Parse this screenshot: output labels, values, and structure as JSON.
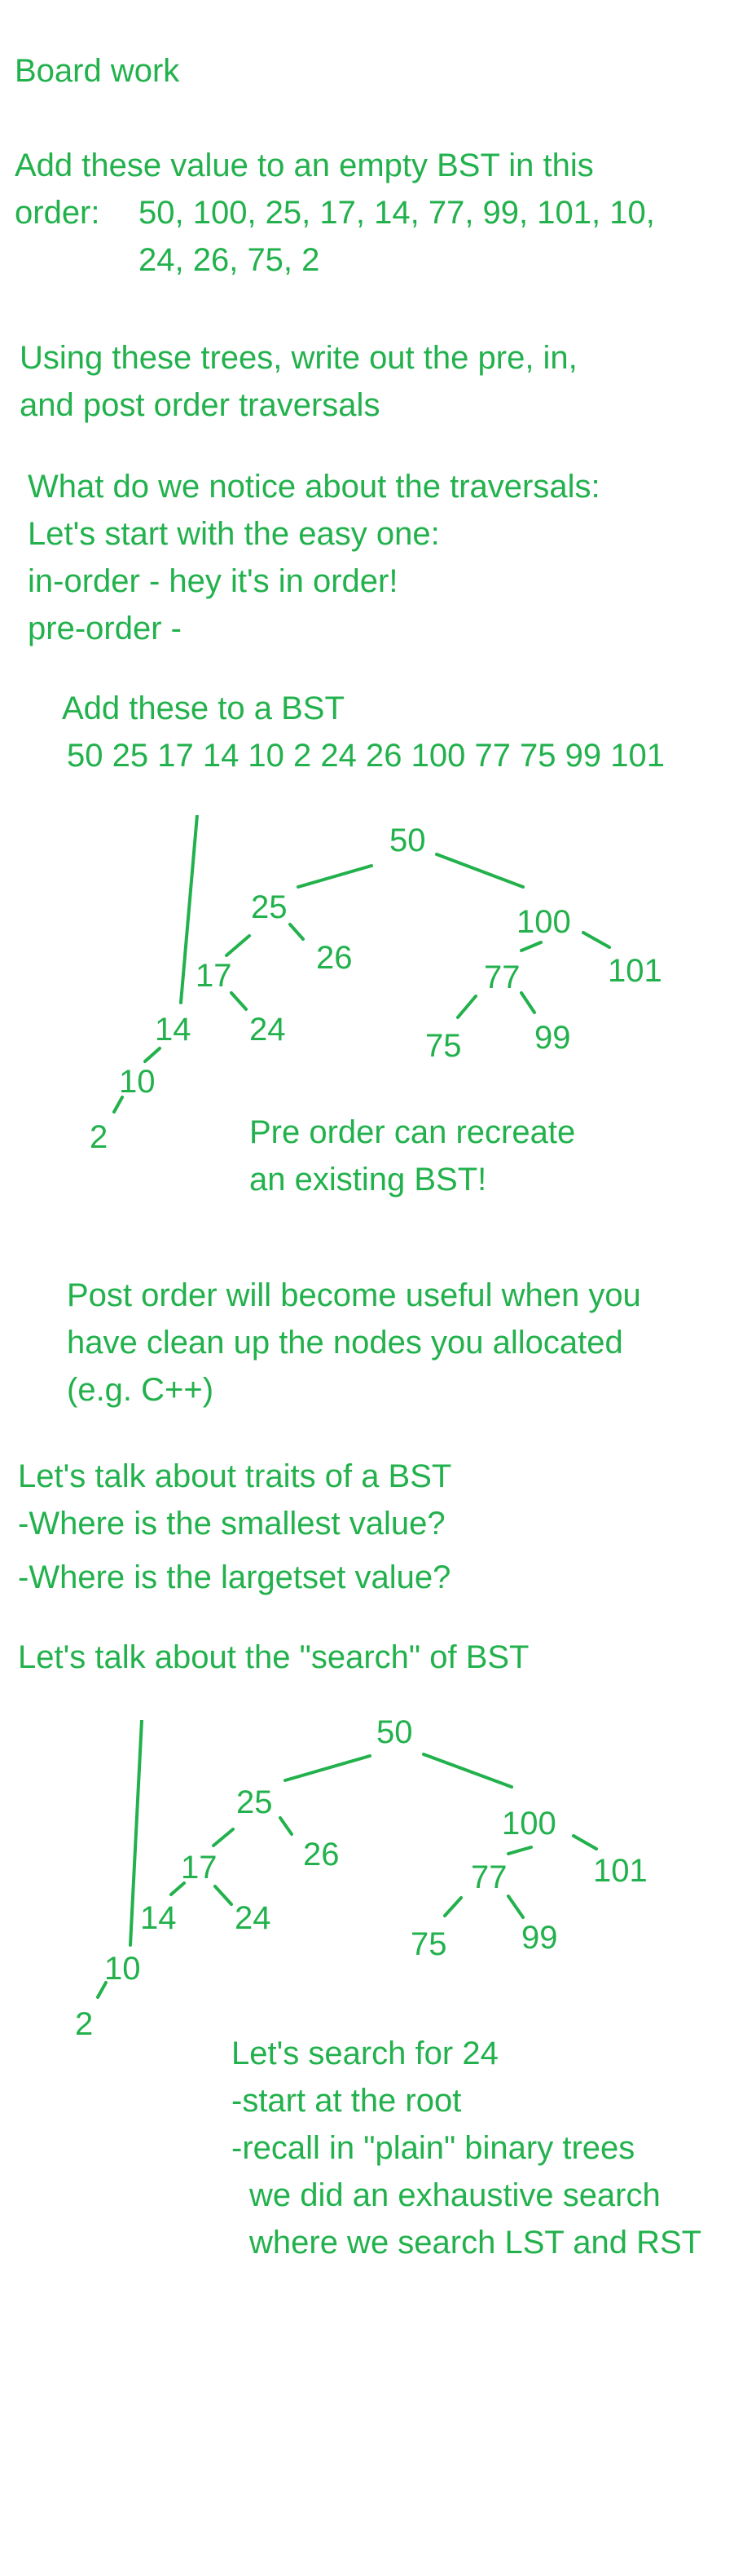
{
  "colors": {
    "ink": "#22b14c",
    "background": "#ffffff"
  },
  "title": "Board work",
  "task_add": {
    "line1": "Add these value to an empty BST in this",
    "order_label": "order:",
    "values_line1": "50, 100, 25, 17, 14, 77, 99, 101, 10,",
    "values_line2": "24, 26, 75, 2"
  },
  "task_traversal": {
    "line1": "Using these trees, write out the pre, in,",
    "line2": "and post order traversals"
  },
  "notice": {
    "line1": "What do we notice about the traversals:",
    "line2": "Let's start with the easy one:",
    "line3": "in-order - hey it's in order!",
    "line4": "pre-order -"
  },
  "preorder_task": {
    "line1": "Add these to a BST",
    "sequence": "50 25 17 14 10 2 24 26 100 77 75 99 101"
  },
  "tree1": {
    "nodes": [
      "50",
      "25",
      "26",
      "17",
      "24",
      "14",
      "10",
      "2",
      "100",
      "101",
      "77",
      "75",
      "99"
    ],
    "note_line1": "Pre order can recreate",
    "note_line2": "an existing BST!"
  },
  "postorder_note": {
    "line1": "Post order will become useful when you",
    "line2": "have clean up the nodes you allocated",
    "line3": "(e.g. C++)"
  },
  "traits": {
    "line1": "Let's talk about traits of a BST",
    "line2": "-Where is the smallest value?",
    "line3": "-Where is the largetset value?"
  },
  "search_heading": "Let's talk about the \"search\" of BST",
  "tree2": {
    "nodes": [
      "50",
      "25",
      "26",
      "17",
      "24",
      "14",
      "10",
      "2",
      "100",
      "101",
      "77",
      "75",
      "99"
    ]
  },
  "search_notes": {
    "line1": "Let's search for 24",
    "line2": "-start at the root",
    "line3": "-recall in \"plain\" binary trees",
    "line4": "we did an exhaustive search",
    "line5": "where we search LST and RST"
  }
}
